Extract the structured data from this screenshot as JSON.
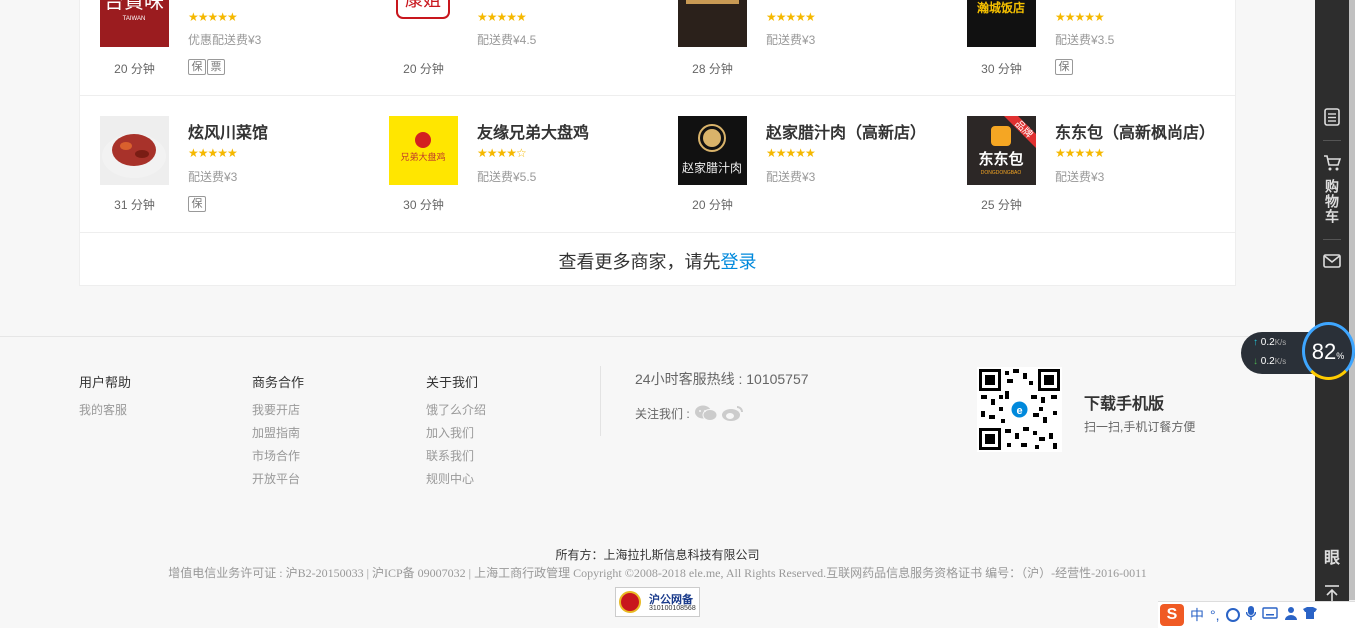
{
  "shops_row1": [
    {
      "name": "",
      "stars": "★★★★★",
      "fee": "优惠配送费¥3",
      "time": "20 分钟",
      "tags": [
        "保",
        "票"
      ],
      "logo_text": "台資味",
      "logo_sub": "TAIWAN",
      "logo_bg": "#9b1c1f"
    },
    {
      "name": "",
      "stars": "★★★★★",
      "fee": "配送费¥4.5",
      "time": "20 分钟",
      "tags": [],
      "logo_text": "康姐",
      "logo_bg": "#ffffff"
    },
    {
      "name": "",
      "stars": "★★★★★",
      "fee": "配送费¥3",
      "time": "28 分钟",
      "tags": [],
      "logo_text": "",
      "logo_bg": "#2b211b"
    },
    {
      "name": "",
      "stars": "★★★★★",
      "fee": "配送费¥3.5",
      "time": "30 分钟",
      "tags": [
        "保"
      ],
      "logo_text": "瀚城饭店",
      "logo_bg": "#111111"
    }
  ],
  "shops_row2": [
    {
      "name": "炫风川菜馆",
      "stars": "★★★★★",
      "fee": "配送费¥3",
      "time": "31 分钟",
      "tags": [
        "保"
      ],
      "logo_text": "",
      "logo_bg": "#a8322a"
    },
    {
      "name": "友缘兄弟大盘鸡",
      "stars": "★★★★☆",
      "fee": "配送费¥5.5",
      "time": "30 分钟",
      "tags": [],
      "logo_text": "兄弟大盘鸡",
      "logo_bg": "#ffe600"
    },
    {
      "name": "赵家腊汁肉（高新店）",
      "stars": "★★★★★",
      "fee": "配送费¥3",
      "time": "20 分钟",
      "tags": [],
      "logo_text": "赵家腊汁肉",
      "logo_bg": "#111111"
    },
    {
      "name": "东东包（高新枫尚店）",
      "stars": "★★★★★",
      "fee": "配送费¥3",
      "time": "25 分钟",
      "tags": [],
      "logo_text": "东东包",
      "logo_sub": "DONGDONGBAO",
      "logo_ribbon": "品牌",
      "logo_bg": "#2c2726"
    }
  ],
  "more": {
    "text": "查看更多商家，请先",
    "login": "登录"
  },
  "footer": {
    "col1": {
      "title": "用户帮助",
      "links": [
        "我的客服"
      ]
    },
    "col2": {
      "title": "商务合作",
      "links": [
        "我要开店",
        "加盟指南",
        "市场合作",
        "开放平台"
      ]
    },
    "col3": {
      "title": "关于我们",
      "links": [
        "饿了么介绍",
        "加入我们",
        "联系我们",
        "规则中心"
      ]
    },
    "hotline": "24小时客服热线 : 10105757",
    "follow": "关注我们 :",
    "download_title": "下载手机版",
    "download_sub": "扫一扫,手机订餐方便",
    "owner": "所有方：上海拉扎斯信息科技有限公司",
    "licenses": "增值电信业务许可证 : 沪B2-20150033 | 沪ICP备 09007032 | 上海工商行政管理 Copyright ©2008-2018 ele.me, All Rights Reserved.互联网药品信息服务资格证书 编号：（沪）-经营性-2016-0011",
    "badge_title": "沪公网备",
    "badge_num": "31010010856​8"
  },
  "sidebar": {
    "cart": "购物车",
    "extra": "眼"
  },
  "net": {
    "up": "0.2",
    "down": "0.2",
    "unit": "K/s",
    "gauge": "82",
    "gauge_unit": "%"
  },
  "ime": {
    "logo": "S",
    "mode": "中",
    "punct": "°,"
  },
  "colors": {
    "link": "#0089dc",
    "star": "#f5b800"
  }
}
